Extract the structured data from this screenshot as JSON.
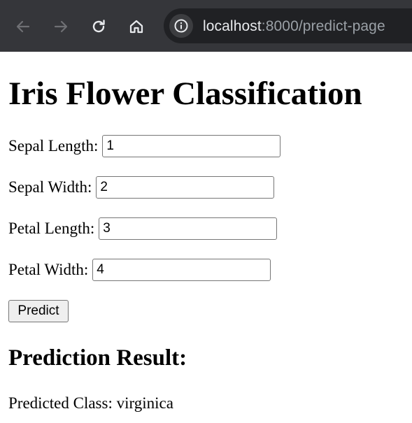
{
  "browser": {
    "url_host": "localhost",
    "url_rest": ":8000/predict-page",
    "icons": [
      "back-icon",
      "forward-icon",
      "reload-icon",
      "home-icon",
      "site-info-icon"
    ]
  },
  "page": {
    "title": "Iris Flower Classification",
    "fields": [
      {
        "label": "Sepal Length:",
        "value": "1"
      },
      {
        "label": "Sepal Width:",
        "value": "2"
      },
      {
        "label": "Petal Length:",
        "value": "3"
      },
      {
        "label": "Petal Width:",
        "value": "4"
      }
    ],
    "predict_label": "Predict",
    "result_heading": "Prediction Result:",
    "result_text": "Predicted Class: virginica"
  }
}
